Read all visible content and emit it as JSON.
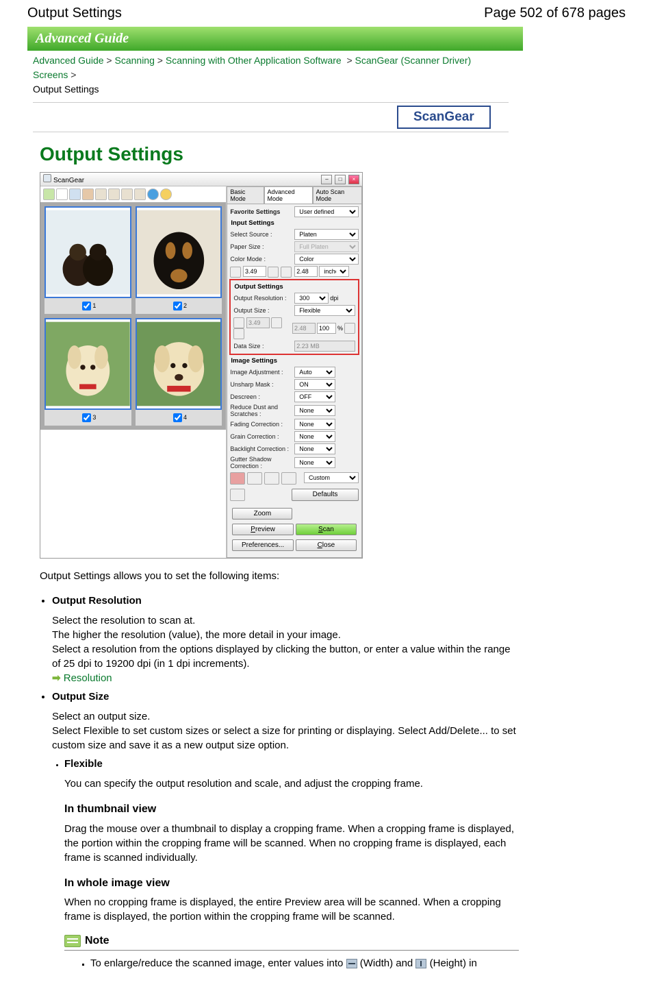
{
  "header": {
    "title": "Output Settings",
    "page_indicator": "Page 502 of 678 pages"
  },
  "banner": {
    "label": "Advanced Guide"
  },
  "breadcrumb": {
    "items": [
      "Advanced Guide",
      "Scanning",
      "Scanning with Other Application Software",
      "ScanGear (Scanner Driver) Screens"
    ],
    "current": "Output Settings",
    "sep": ">"
  },
  "badge": {
    "label": "ScanGear"
  },
  "section_title": "Output Settings",
  "screenshot": {
    "window_title": "ScanGear",
    "thumbs": [
      {
        "idx": "1",
        "checked": true
      },
      {
        "idx": "2",
        "checked": true
      },
      {
        "idx": "3",
        "checked": true
      },
      {
        "idx": "4",
        "checked": true
      }
    ],
    "tabs": {
      "basic": "Basic Mode",
      "advanced": "Advanced Mode",
      "auto": "Auto Scan Mode"
    },
    "favorite": {
      "label": "Favorite Settings",
      "value": "User defined"
    },
    "input": {
      "head": "Input Settings",
      "source_lbl": "Select Source :",
      "source_val": "Platen",
      "paper_lbl": "Paper Size :",
      "paper_val": "Full Platen",
      "color_lbl": "Color Mode :",
      "color_val": "Color",
      "w": "3.49",
      "h": "2.48",
      "unit": "inches"
    },
    "output": {
      "head": "Output Settings",
      "res_lbl": "Output Resolution :",
      "res_val": "300",
      "res_unit": "dpi",
      "size_lbl": "Output Size :",
      "size_val": "Flexible",
      "ow": "3.49",
      "oh": "2.48",
      "pct": "100",
      "pct_unit": "%",
      "data_lbl": "Data Size :",
      "data_val": "2.23 MB"
    },
    "image": {
      "head": "Image Settings",
      "rows": [
        {
          "lbl": "Image Adjustment :",
          "val": "Auto"
        },
        {
          "lbl": "Unsharp Mask :",
          "val": "ON"
        },
        {
          "lbl": "Descreen :",
          "val": "OFF"
        },
        {
          "lbl": "Reduce Dust and Scratches :",
          "val": "None"
        },
        {
          "lbl": "Fading Correction :",
          "val": "None"
        },
        {
          "lbl": "Grain Correction :",
          "val": "None"
        },
        {
          "lbl": "Backlight Correction :",
          "val": "None"
        },
        {
          "lbl": "Gutter Shadow Correction :",
          "val": "None"
        }
      ]
    },
    "bottom": {
      "custom": "Custom",
      "defaults": "Defaults",
      "zoom": "Zoom",
      "preview": "Preview",
      "scan": "Scan",
      "prefs": "Preferences...",
      "close": "Close"
    }
  },
  "body": {
    "intro": "Output Settings allows you to set the following items:",
    "res_head": "Output Resolution",
    "res_p1": "Select the resolution to scan at.",
    "res_p2": "The higher the resolution (value), the more detail in your image.",
    "res_p3": "Select a resolution from the options displayed by clicking the button, or enter a value within the range of 25 dpi to 19200 dpi (in 1 dpi increments).",
    "res_link": "Resolution",
    "size_head": "Output Size",
    "size_p1": "Select an output size.",
    "size_p2": "Select Flexible to set custom sizes or select a size for printing or displaying. Select Add/Delete... to set custom size and save it as a new output size option.",
    "flex_head": "Flexible",
    "flex_p": "You can specify the output resolution and scale, and adjust the cropping frame.",
    "thumb_head": "In thumbnail view",
    "thumb_p": "Drag the mouse over a thumbnail to display a cropping frame. When a cropping frame is displayed, the portion within the cropping frame will be scanned. When no cropping frame is displayed, each frame is scanned individually.",
    "whole_head": "In whole image view",
    "whole_p": "When no cropping frame is displayed, the entire Preview area will be scanned. When a cropping frame is displayed, the portion within the cropping frame will be scanned.",
    "note_head": "Note",
    "note_p_a": "To enlarge/reduce the scanned image, enter values into ",
    "note_p_b": " (Width) and ",
    "note_p_c": " (Height) in"
  }
}
